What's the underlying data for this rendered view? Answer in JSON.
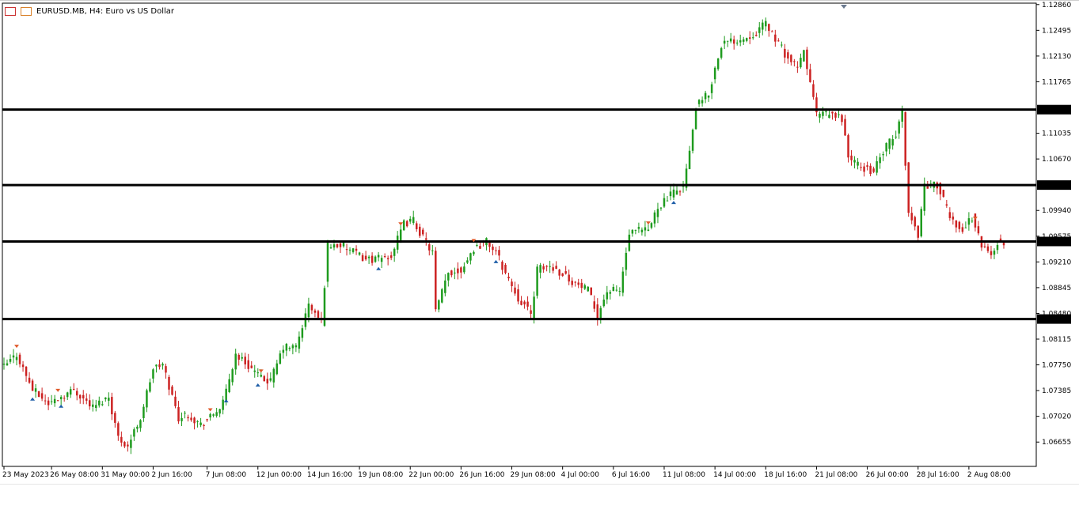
{
  "header": {
    "title": "EURUSD.MB, H4:  Euro vs US Dollar"
  },
  "chart_data": {
    "type": "candlestick",
    "symbol": "EURUSD.MB",
    "timeframe": "H4",
    "ylim": [
      1.0631,
      1.1288
    ],
    "y_ticks": [
      "1.12860",
      "1.12495",
      "1.12130",
      "1.11765",
      "1.11370",
      "1.11035",
      "1.10670",
      "1.10300",
      "1.09940",
      "1.09575",
      "1.09500",
      "1.09210",
      "1.08845",
      "1.08480",
      "1.08400",
      "1.08115",
      "1.07750",
      "1.07385",
      "1.07020",
      "1.06655"
    ],
    "x_ticks": [
      "23 May 2023",
      "26 May 08:00",
      "31 May 00:00",
      "2 Jun 16:00",
      "7 Jun 08:00",
      "12 Jun 00:00",
      "14 Jun 16:00",
      "19 Jun 08:00",
      "22 Jun 00:00",
      "26 Jun 16:00",
      "29 Jun 08:00",
      "4 Jul 00:00",
      "6 Jul 16:00",
      "11 Jul 08:00",
      "14 Jul 00:00",
      "18 Jul 16:00",
      "21 Jul 08:00",
      "26 Jul 00:00",
      "28 Jul 16:00",
      "2 Aug 08:00"
    ],
    "horizontal_levels": [
      1.1137,
      1.103,
      1.095,
      1.084
    ],
    "level_labels": [
      "1.11370",
      "1.10300",
      "1.09500",
      "1.08400"
    ],
    "anchors": [
      {
        "i": 0,
        "p": 1.0772
      },
      {
        "i": 4,
        "p": 1.079
      },
      {
        "i": 9,
        "p": 1.074
      },
      {
        "i": 14,
        "p": 1.072
      },
      {
        "i": 22,
        "p": 1.074
      },
      {
        "i": 28,
        "p": 1.0715
      },
      {
        "i": 33,
        "p": 1.073
      },
      {
        "i": 36,
        "p": 1.0672
      },
      {
        "i": 39,
        "p": 1.066
      },
      {
        "i": 43,
        "p": 1.07
      },
      {
        "i": 47,
        "p": 1.077
      },
      {
        "i": 50,
        "p": 1.0775
      },
      {
        "i": 55,
        "p": 1.07
      },
      {
        "i": 58,
        "p": 1.0705
      },
      {
        "i": 62,
        "p": 1.069
      },
      {
        "i": 65,
        "p": 1.07
      },
      {
        "i": 69,
        "p": 1.072
      },
      {
        "i": 73,
        "p": 1.079
      },
      {
        "i": 78,
        "p": 1.077
      },
      {
        "i": 81,
        "p": 1.0755
      },
      {
        "i": 84,
        "p": 1.0752
      },
      {
        "i": 88,
        "p": 1.08
      },
      {
        "i": 92,
        "p": 1.08
      },
      {
        "i": 96,
        "p": 1.086
      },
      {
        "i": 100,
        "p": 1.0835
      },
      {
        "i": 102,
        "p": 1.0945
      },
      {
        "i": 106,
        "p": 1.0945
      },
      {
        "i": 110,
        "p": 1.0935
      },
      {
        "i": 114,
        "p": 1.0925
      },
      {
        "i": 118,
        "p": 1.0925
      },
      {
        "i": 122,
        "p": 1.093
      },
      {
        "i": 126,
        "p": 1.0975
      },
      {
        "i": 129,
        "p": 1.098
      },
      {
        "i": 132,
        "p": 1.0955
      },
      {
        "i": 135,
        "p": 1.0935
      },
      {
        "i": 136,
        "p": 1.085
      },
      {
        "i": 140,
        "p": 1.0905
      },
      {
        "i": 144,
        "p": 1.091
      },
      {
        "i": 148,
        "p": 1.094
      },
      {
        "i": 152,
        "p": 1.095
      },
      {
        "i": 155,
        "p": 1.0935
      },
      {
        "i": 158,
        "p": 1.0905
      },
      {
        "i": 162,
        "p": 1.087
      },
      {
        "i": 164,
        "p": 1.086
      },
      {
        "i": 166,
        "p": 1.0845
      },
      {
        "i": 168,
        "p": 1.091
      },
      {
        "i": 172,
        "p": 1.0915
      },
      {
        "i": 176,
        "p": 1.0905
      },
      {
        "i": 180,
        "p": 1.089
      },
      {
        "i": 184,
        "p": 1.088
      },
      {
        "i": 187,
        "p": 1.0845
      },
      {
        "i": 190,
        "p": 1.088
      },
      {
        "i": 194,
        "p": 1.088
      },
      {
        "i": 197,
        "p": 1.096
      },
      {
        "i": 200,
        "p": 1.0965
      },
      {
        "i": 203,
        "p": 1.0965
      },
      {
        "i": 206,
        "p": 1.1
      },
      {
        "i": 210,
        "p": 1.1015
      },
      {
        "i": 214,
        "p": 1.103
      },
      {
        "i": 216,
        "p": 1.1075
      },
      {
        "i": 218,
        "p": 1.114
      },
      {
        "i": 222,
        "p": 1.116
      },
      {
        "i": 226,
        "p": 1.123
      },
      {
        "i": 230,
        "p": 1.1235
      },
      {
        "i": 234,
        "p": 1.124
      },
      {
        "i": 238,
        "p": 1.125
      },
      {
        "i": 240,
        "p": 1.126
      },
      {
        "i": 244,
        "p": 1.123
      },
      {
        "i": 247,
        "p": 1.121
      },
      {
        "i": 250,
        "p": 1.1195
      },
      {
        "i": 252,
        "p": 1.122
      },
      {
        "i": 254,
        "p": 1.1175
      },
      {
        "i": 256,
        "p": 1.113
      },
      {
        "i": 260,
        "p": 1.113
      },
      {
        "i": 264,
        "p": 1.1125
      },
      {
        "i": 266,
        "p": 1.107
      },
      {
        "i": 270,
        "p": 1.1055
      },
      {
        "i": 274,
        "p": 1.105
      },
      {
        "i": 278,
        "p": 1.1085
      },
      {
        "i": 281,
        "p": 1.11
      },
      {
        "i": 283,
        "p": 1.1135
      },
      {
        "i": 285,
        "p": 1.099
      },
      {
        "i": 288,
        "p": 1.096
      },
      {
        "i": 290,
        "p": 1.103
      },
      {
        "i": 294,
        "p": 1.103
      },
      {
        "i": 298,
        "p": 1.0985
      },
      {
        "i": 302,
        "p": 1.0965
      },
      {
        "i": 305,
        "p": 1.0985
      },
      {
        "i": 308,
        "p": 1.0945
      },
      {
        "i": 311,
        "p": 1.093
      },
      {
        "i": 313,
        "p": 1.095
      },
      {
        "i": 315,
        "p": 1.0945
      }
    ],
    "candle_count": 316,
    "up_color": "#1e9b1e",
    "down_color": "#cc2222",
    "level_color": "#000000",
    "markers": [
      {
        "i": 4,
        "type": "sell"
      },
      {
        "i": 9,
        "type": "buy"
      },
      {
        "i": 17,
        "type": "sell"
      },
      {
        "i": 18,
        "type": "buy"
      },
      {
        "i": 65,
        "type": "sell"
      },
      {
        "i": 70,
        "type": "buy"
      },
      {
        "i": 80,
        "type": "buy"
      },
      {
        "i": 81,
        "type": "sell"
      },
      {
        "i": 118,
        "type": "buy"
      },
      {
        "i": 125,
        "type": "sell"
      },
      {
        "i": 148,
        "type": "sell"
      },
      {
        "i": 155,
        "type": "buy"
      },
      {
        "i": 203,
        "type": "sell"
      },
      {
        "i": 211,
        "type": "buy"
      },
      {
        "i": 306,
        "type": "sell"
      }
    ]
  }
}
